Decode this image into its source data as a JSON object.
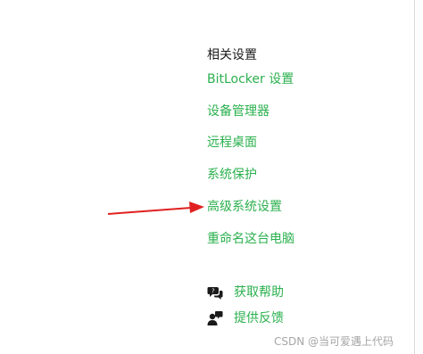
{
  "colors": {
    "link": "#2bb04e",
    "arrow": "#e02020",
    "text": "#1a1a1a",
    "watermark": "#a6a6a6"
  },
  "related": {
    "title": "相关设置",
    "links": [
      {
        "label": "BitLocker 设置"
      },
      {
        "label": "设备管理器"
      },
      {
        "label": "远程桌面"
      },
      {
        "label": "系统保护"
      },
      {
        "label": "高级系统设置"
      },
      {
        "label": "重命名这台电脑"
      }
    ]
  },
  "help": {
    "get_help": {
      "label": "获取帮助",
      "icon": "chat-help-icon"
    },
    "feedback": {
      "label": "提供反馈",
      "icon": "feedback-person-icon"
    }
  },
  "annotation": {
    "arrow_points_to": "高级系统设置"
  },
  "watermark": "CSDN @当可爱遇上代码"
}
